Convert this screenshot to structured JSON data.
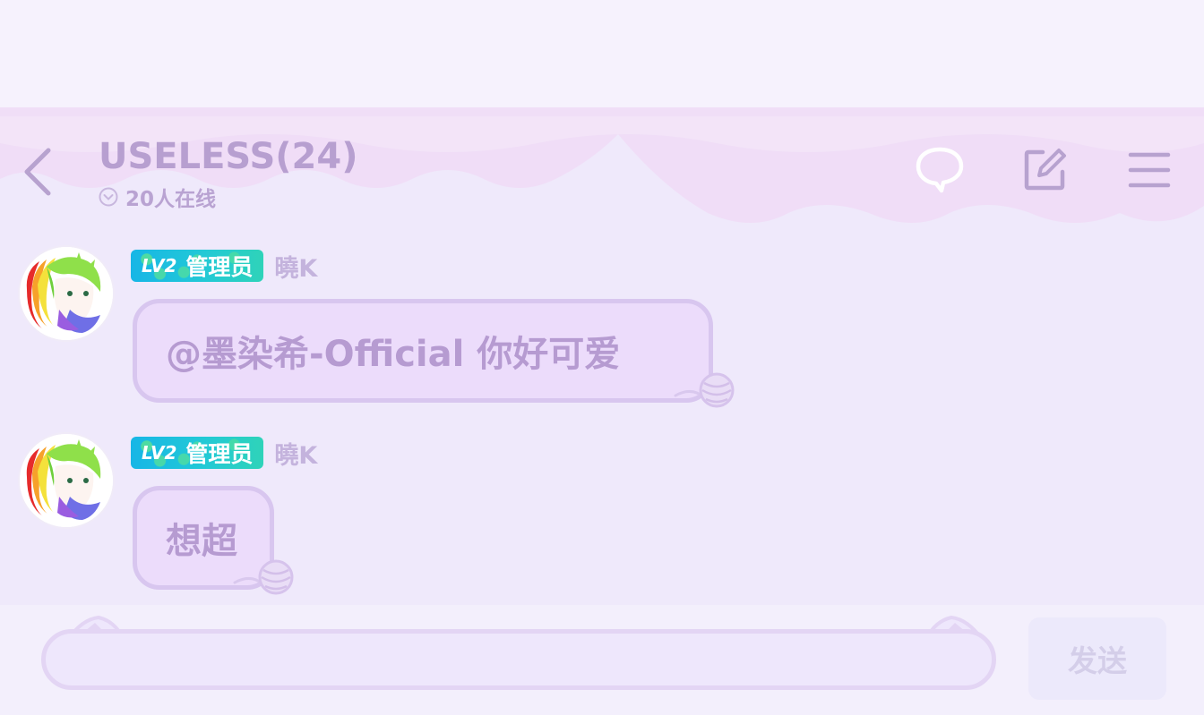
{
  "header": {
    "title": "USELESS(24)",
    "online_text": "20人在线",
    "icons": {
      "back": "chevron-left-icon",
      "online": "chevron-down-circle-icon",
      "chat": "speech-bubble-icon",
      "edit": "edit-square-icon",
      "menu": "hamburger-menu-icon"
    }
  },
  "messages": [
    {
      "badge_level": "LV2",
      "badge_role": "管理员",
      "username": "曉K",
      "text": "@墨染希-Official 你好可爱"
    },
    {
      "badge_level": "LV2",
      "badge_role": "管理员",
      "username": "曉K",
      "text": "想超"
    }
  ],
  "composer": {
    "input_value": "",
    "input_placeholder": "",
    "send_label": "发送"
  },
  "colors": {
    "background": "#efe9fb",
    "accent_purple": "#b79fd0",
    "bubble_fill": "#ecdcfb",
    "badge_cyan": "#17b6e6",
    "send_disabled": "#d4cee9"
  }
}
